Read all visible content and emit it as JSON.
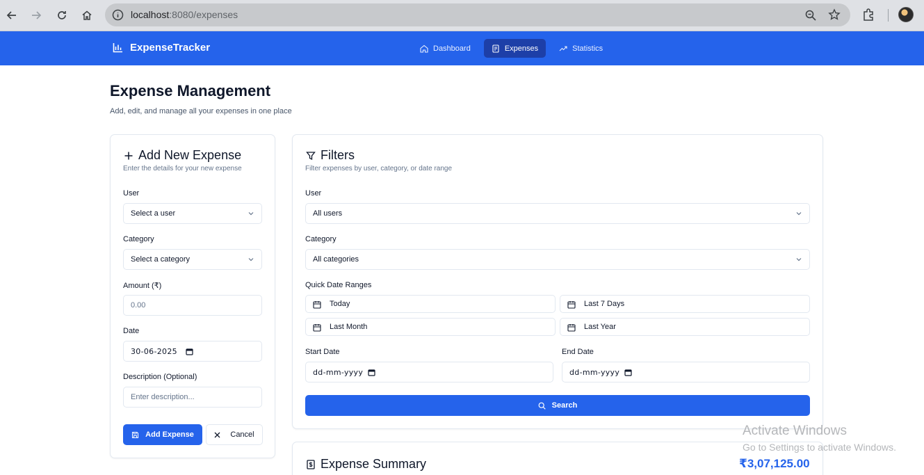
{
  "browser": {
    "url_host": "localhost",
    "url_rest": ":8080/expenses"
  },
  "app": {
    "brand": "ExpenseTracker",
    "nav": [
      {
        "label": "Dashboard",
        "icon": "home-icon",
        "active": false
      },
      {
        "label": "Expenses",
        "icon": "receipt-icon",
        "active": true
      },
      {
        "label": "Statistics",
        "icon": "trending-up-icon",
        "active": false
      }
    ]
  },
  "page": {
    "title": "Expense Management",
    "subtitle": "Add, edit, and manage all your expenses in one place"
  },
  "add_form": {
    "title": "Add New Expense",
    "description": "Enter the details for your new expense",
    "user_label": "User",
    "user_value": "Select a user",
    "category_label": "Category",
    "category_value": "Select a category",
    "amount_label": "Amount (₹)",
    "amount_placeholder": "0.00",
    "date_label": "Date",
    "date_value": "30-06-2025",
    "description_label": "Description (Optional)",
    "description_placeholder": "Enter description...",
    "submit_label": "Add Expense",
    "cancel_label": "Cancel"
  },
  "filters": {
    "title": "Filters",
    "description": "Filter expenses by user, category, or date range",
    "user_label": "User",
    "user_value": "All users",
    "category_label": "Category",
    "category_value": "All categories",
    "quick_label": "Quick Date Ranges",
    "quick_ranges": [
      "Today",
      "Last 7 Days",
      "Last Month",
      "Last Year"
    ],
    "start_label": "Start Date",
    "start_value": "dd-mm-yyyy",
    "end_label": "End Date",
    "end_value": "dd-mm-yyyy",
    "search_label": "Search"
  },
  "summary": {
    "title": "Expense Summary",
    "total": "₹3,07,125.00"
  },
  "watermark": {
    "line1": "Activate Windows",
    "line2": "Go to Settings to activate Windows."
  },
  "colors": {
    "primary": "#2563eb",
    "nav_active": "#1d3fa8"
  }
}
